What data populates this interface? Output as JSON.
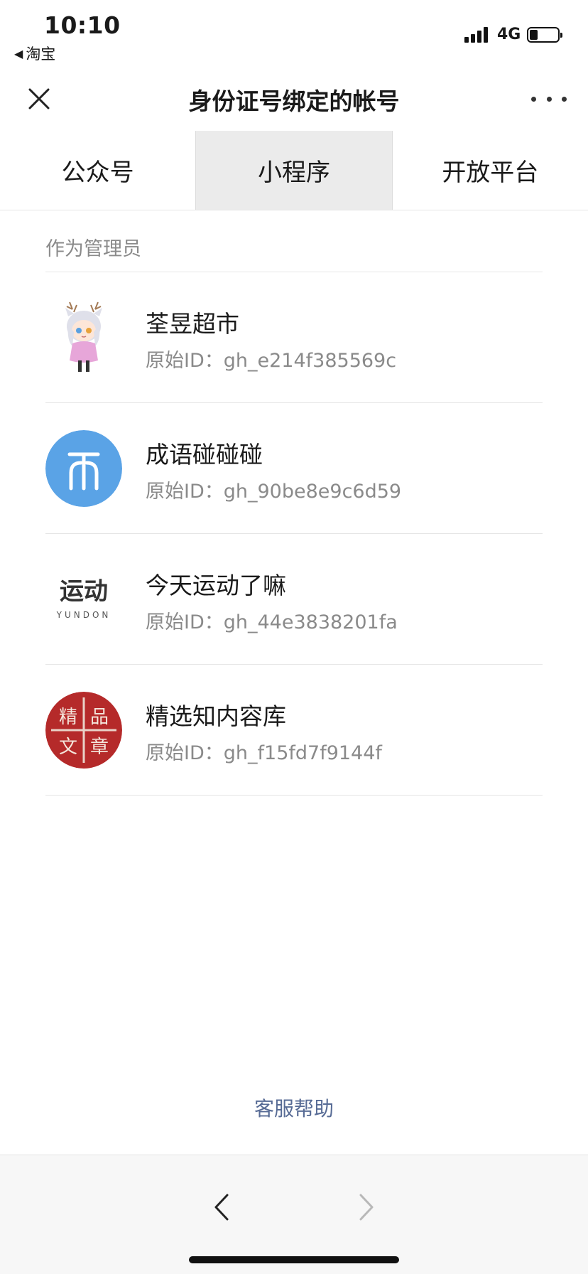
{
  "status_bar": {
    "time": "10:10",
    "back_app": "淘宝",
    "network": "4G",
    "battery_level": 0.3
  },
  "nav": {
    "title": "身份证号绑定的帐号",
    "close_icon": "close-icon",
    "more_icon": "more-icon"
  },
  "tabs": [
    {
      "label": "公众号",
      "active": false
    },
    {
      "label": "小程序",
      "active": true
    },
    {
      "label": "开放平台",
      "active": false
    }
  ],
  "section": {
    "label": "作为管理员"
  },
  "items": [
    {
      "name": "荃昱超市",
      "id": "原始ID：gh_e214f385569c",
      "icon": "anime-girl-avatar"
    },
    {
      "name": "成语碰碰碰",
      "id": "原始ID：gh_90be8e9c6d59",
      "icon": "blue-circle-logo"
    },
    {
      "name": "今天运动了嘛",
      "id": "原始ID：gh_44e3838201fa",
      "icon": "yundong-logo",
      "logo_text": "运动",
      "logo_sub": "YUNDON"
    },
    {
      "name": "精选知内容库",
      "id": "原始ID：gh_f15fd7f9144f",
      "icon": "seal-logo",
      "seal_chars": [
        "精",
        "品",
        "文",
        "章"
      ]
    }
  ],
  "help": {
    "label": "客服帮助"
  },
  "colors": {
    "link": "#576b95",
    "tab_active_bg": "#ebebeb",
    "blue_logo": "#5aa3e6",
    "seal_red": "#b52a2a"
  }
}
